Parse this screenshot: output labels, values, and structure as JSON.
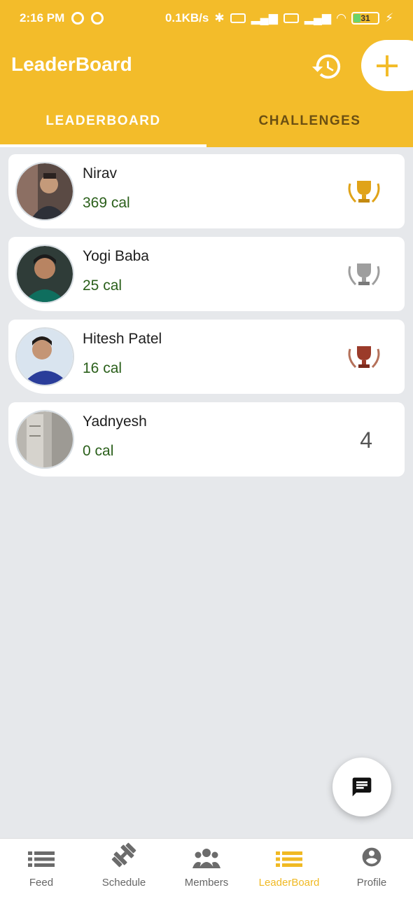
{
  "status_bar": {
    "time": "2:16 PM",
    "speed": "0.1KB/s",
    "battery": "31"
  },
  "app_bar": {
    "title": "LeaderBoard"
  },
  "tabs": [
    {
      "label": "LEADERBOARD",
      "active": true
    },
    {
      "label": "CHALLENGES",
      "active": false
    }
  ],
  "leaderboard": [
    {
      "name": "Nirav",
      "calories": "369 cal",
      "trophy": "gold-trophy-icon",
      "trophy_color": "#e0a318"
    },
    {
      "name": "Yogi Baba",
      "calories": "25 cal",
      "trophy": "silver-trophy-icon",
      "trophy_color": "#9e9e9e"
    },
    {
      "name": "Hitesh Patel",
      "calories": "16 cal",
      "trophy": "bronze-trophy-icon",
      "trophy_color": "#9b3b2a"
    },
    {
      "name": "Yadnyesh",
      "calories": "0 cal",
      "rank": "4"
    }
  ],
  "bottom_nav": [
    {
      "label": "Feed",
      "icon": "feed-list-icon"
    },
    {
      "label": "Schedule",
      "icon": "dumbbell-icon"
    },
    {
      "label": "Members",
      "icon": "members-group-icon"
    },
    {
      "label": "LeaderBoard",
      "icon": "leaderboard-list-icon",
      "active": true
    },
    {
      "label": "Profile",
      "icon": "profile-icon"
    }
  ],
  "colors": {
    "primary": "#f3bc2a",
    "calorie_text": "#2a5f1a",
    "active_nav": "#f0b923"
  }
}
